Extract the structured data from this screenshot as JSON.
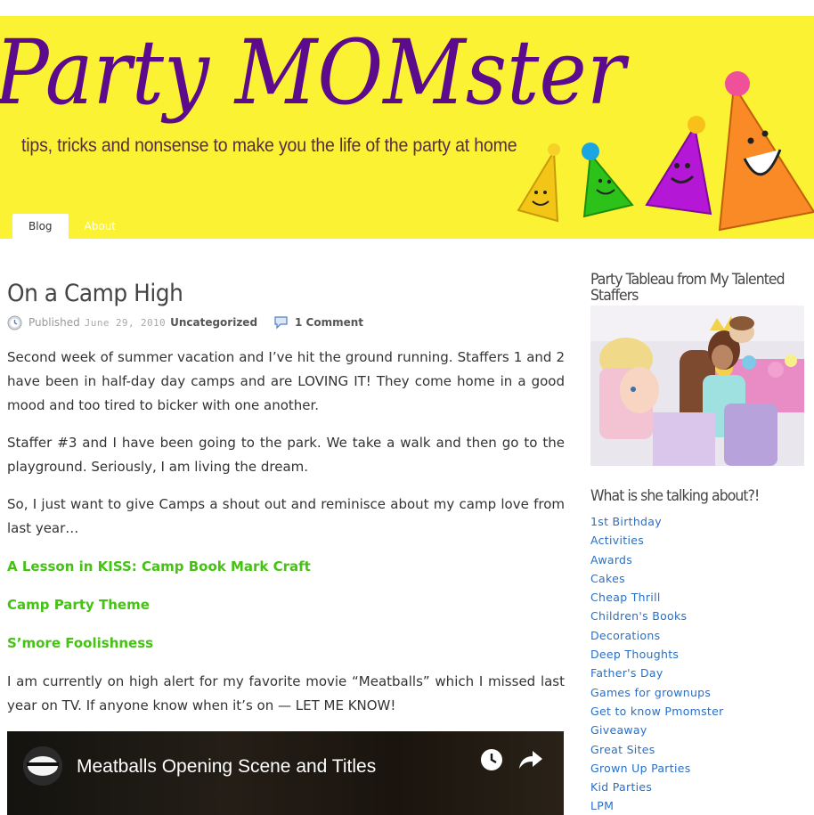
{
  "site": {
    "logo_text": "Party MOMster",
    "tagline": "tips, tricks and nonsense to make you the life of the party at home",
    "colors": {
      "header_bg": "#fbf233",
      "logo": "#5b0b8c",
      "link": "#2a6fc4",
      "green_link": "#45c213"
    }
  },
  "nav": {
    "tabs": [
      {
        "label": "Blog",
        "active": true
      },
      {
        "label": "About",
        "active": false
      }
    ]
  },
  "post": {
    "title": "On a Camp High",
    "meta": {
      "published_label": "Published",
      "date": "June 29, 2010",
      "category": "Uncategorized",
      "comments": "1 Comment"
    },
    "paragraphs": [
      "Second week of summer vacation and I’ve hit the ground running. Staffers 1 and 2 have been in half-day day camps and are LOVING IT! They come home in a good mood and too tired to bicker with one another.",
      "Staffer #3 and I have been going to the park. We take a walk and then go to the playground. Seriously, I am living the dream.",
      "So, I just want to give Camps a shout out and reminisce about my camp love from last year…"
    ],
    "links": [
      "A Lesson in KISS: Camp Book Mark Craft",
      "Camp Party Theme",
      "S’more Foolishness"
    ],
    "closing": "I am currently on high alert for my favorite movie “Meatballs” which I missed last year on TV. If anyone know when it’s on — LET ME KNOW!",
    "video": {
      "title": "Meatballs Opening Scene and Titles"
    }
  },
  "sidebar": {
    "tableau_title": "Party Tableau from My Talented Staffers",
    "categories_title": "What is she talking about?!",
    "categories": [
      "1st Birthday",
      "Activities",
      "Awards",
      "Cakes",
      "Cheap Thrill",
      "Children's Books",
      "Decorations",
      "Deep Thoughts",
      "Father's Day",
      "Games for grownups",
      "Get to know Pmomster",
      "Giveaway",
      "Great Sites",
      "Grown Up Parties",
      "Kid Parties",
      "LPM"
    ]
  }
}
